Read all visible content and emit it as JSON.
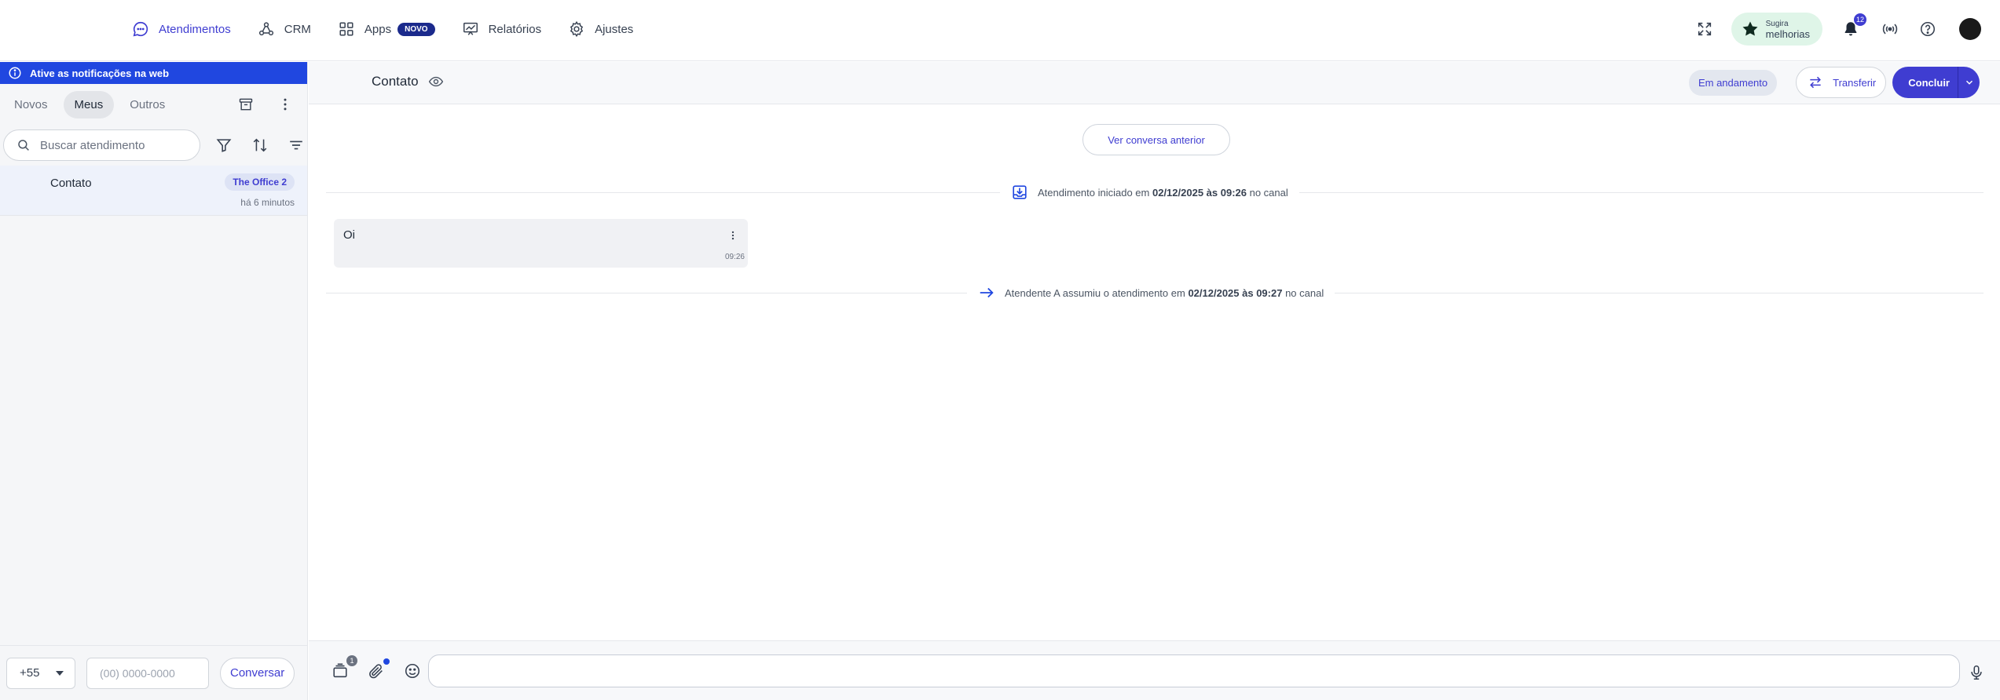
{
  "nav": {
    "items": [
      {
        "label": "Atendimentos",
        "icon": "chat-bubble-icon",
        "active": true
      },
      {
        "label": "CRM",
        "icon": "crm-nodes-icon"
      },
      {
        "label": "Apps",
        "icon": "apps-grid-icon",
        "badge": "NOVO"
      },
      {
        "label": "Relatórios",
        "icon": "presentation-chart-icon"
      },
      {
        "label": "Ajustes",
        "icon": "gear-icon"
      }
    ],
    "suggest_line1": "Sugira",
    "suggest_line2": "melhorias",
    "notification_count": "12"
  },
  "sidebar": {
    "banner": "Ative as notificações na web",
    "tabs": [
      "Novos",
      "Meus",
      "Outros"
    ],
    "active_tab": "Meus",
    "search_placeholder": "Buscar atendimento",
    "conversation": {
      "name": "Contato",
      "tag": "The Office 2",
      "time": "há 6 minutos"
    },
    "footer": {
      "ddi": "+55",
      "phone_placeholder": "(00) 0000-0000",
      "button": "Conversar"
    }
  },
  "chat": {
    "title": "Contato",
    "status": "Em andamento",
    "transfer_label": "Transferir",
    "conclude_label": "Concluir",
    "prev_button": "Ver conversa anterior",
    "events": [
      {
        "prefix": "Atendimento iniciado em",
        "date": "02/12/2025 às 09:26",
        "suffix": "no canal"
      },
      {
        "prefix": "Atendente A assumiu o atendimento em",
        "date": "02/12/2025 às 09:27",
        "suffix": "no canal"
      }
    ],
    "message": {
      "text": "Oi",
      "time": "09:26"
    },
    "composer": {
      "attachments_count": "1",
      "input_value": ""
    }
  },
  "colors": {
    "accent": "#3f3dd1",
    "banner": "#2047e0",
    "suggest_bg": "#dff5e8"
  }
}
